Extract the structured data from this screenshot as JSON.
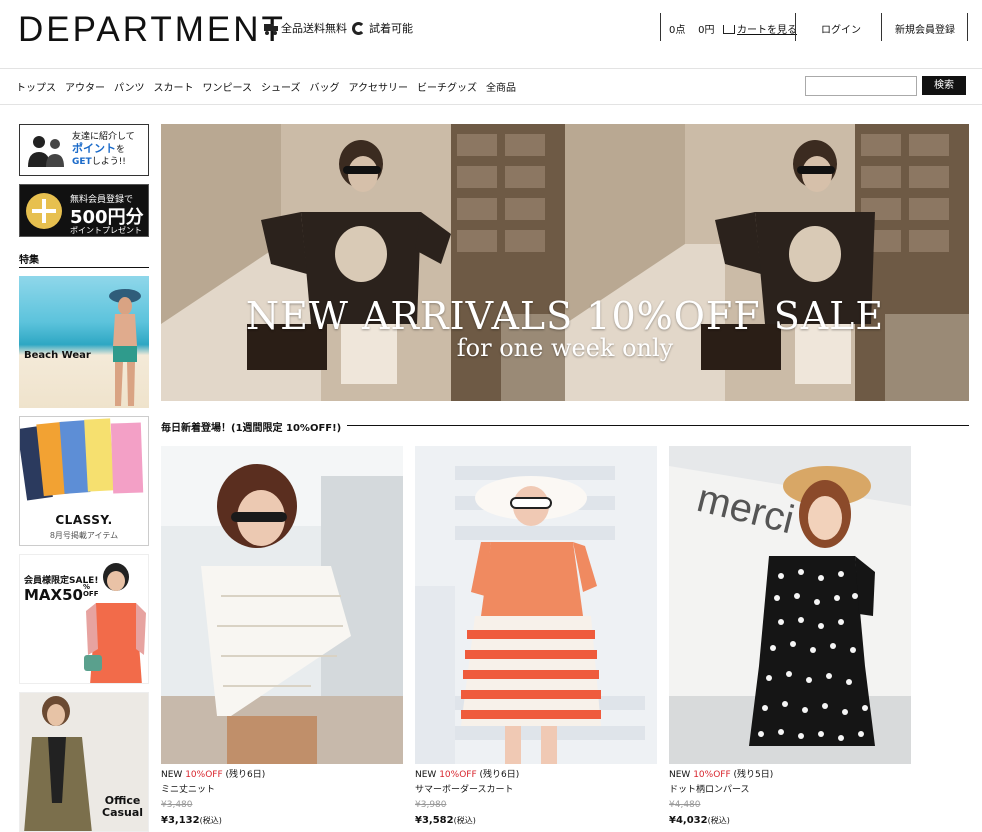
{
  "header": {
    "logo": "DEPARTMENT",
    "free_shipping": "全品送料無料",
    "try_on": "試着可能",
    "cart_count": "0点",
    "cart_amount": "0円",
    "view_cart": "カートを見る",
    "login": "ログイン",
    "register": "新規会員登録"
  },
  "nav": {
    "items": [
      "トップス",
      "アウター",
      "パンツ",
      "スカート",
      "ワンピース",
      "シューズ",
      "バッグ",
      "アクセサリー",
      "ビーチグッズ",
      "全商品"
    ],
    "search_placeholder": "",
    "search_button": "検索"
  },
  "sidebar": {
    "promo_invite": {
      "line1": "友達に紹介して",
      "line2a": "ポイント",
      "line2b": "を",
      "line3a": "GET",
      "line3b": "しよう!!"
    },
    "promo_register": {
      "line1": "無料会員登録で",
      "line2": "500円分",
      "line3": "ポイントプレゼント"
    },
    "feature_heading": "特集",
    "beach_label": "Beach Wear",
    "classy_label": "CLASSY.",
    "classy_sub": "8月号掲載アイテム",
    "member_line1": "会員様限定SALE!",
    "member_line2": "MAX50",
    "member_pct": "%",
    "member_off": "OFF",
    "office_line1": "Office",
    "office_line2": "Casual"
  },
  "hero": {
    "title": "NEW ARRIVALS 10%OFF SALE",
    "subtitle": "for one week only"
  },
  "section": {
    "title": "毎日新着登場！(1週間限定 10%OFF!)"
  },
  "products": [
    {
      "new": "NEW",
      "off": "10%OFF",
      "remain": "(残り6日)",
      "name": "ミニ丈ニット",
      "old_price": "¥3,480",
      "price": "¥3,132",
      "tax": "(税込)"
    },
    {
      "new": "NEW",
      "off": "10%OFF",
      "remain": "(残り6日)",
      "name": "サマーボーダースカート",
      "old_price": "¥3,980",
      "price": "¥3,582",
      "tax": "(税込)"
    },
    {
      "new": "NEW",
      "off": "10%OFF",
      "remain": "(残り5日)",
      "name": "ドット柄ロンパース",
      "old_price": "¥4,480",
      "price": "¥4,032",
      "tax": "(税込)"
    }
  ],
  "colors": {
    "accent_red": "#d8262e",
    "brand_blue": "#1a6ac9",
    "black": "#111111"
  }
}
